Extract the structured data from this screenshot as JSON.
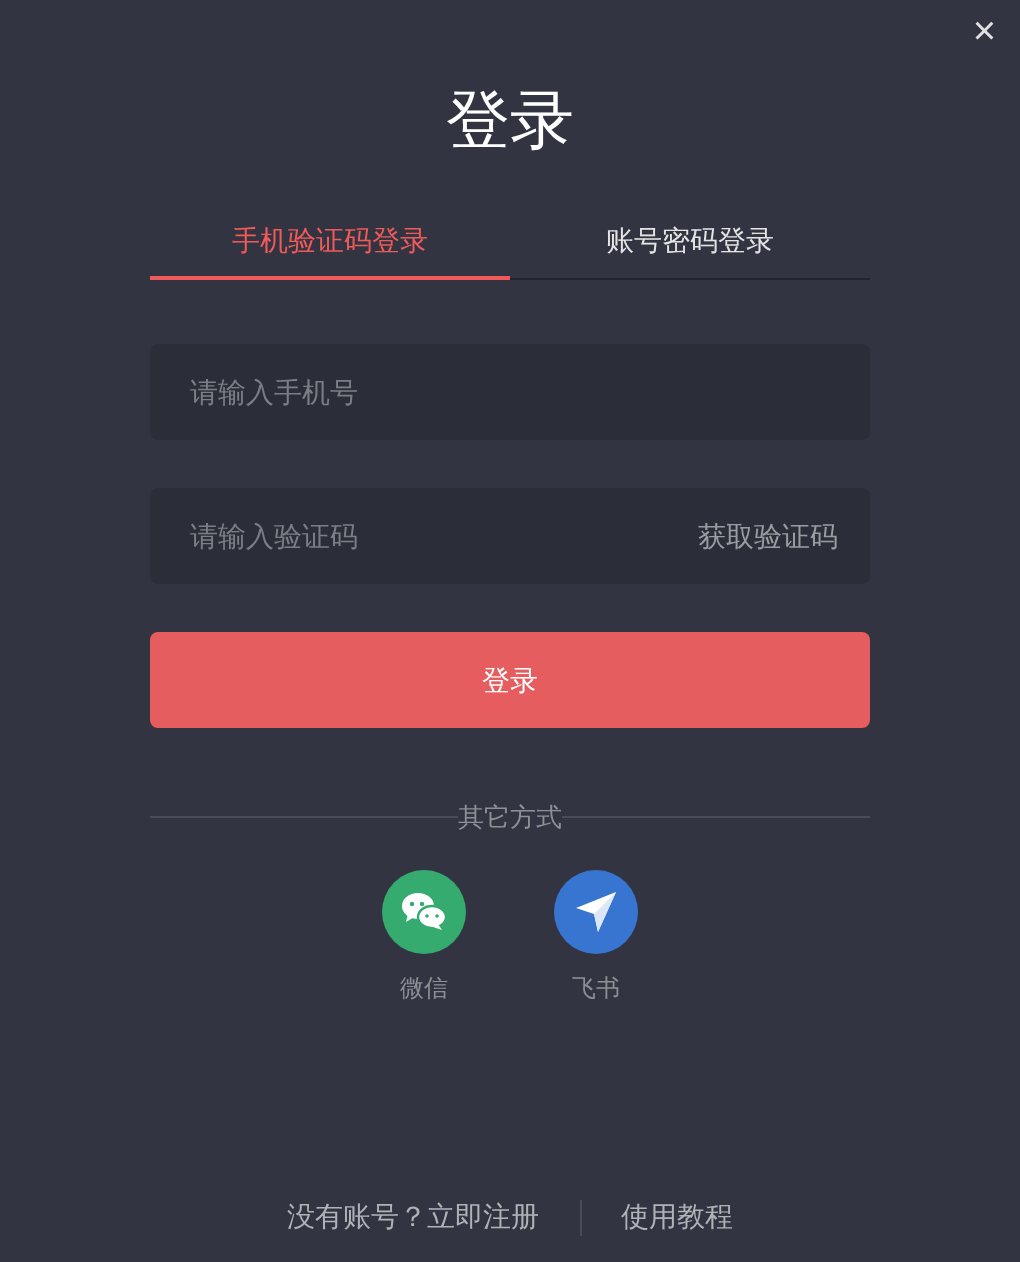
{
  "dialog": {
    "title": "登录",
    "close": "×"
  },
  "tabs": [
    {
      "label": "手机验证码登录",
      "selected": true
    },
    {
      "label": "账号密码登录",
      "selected": false
    }
  ],
  "phone_field": {
    "placeholder": "请输入手机号"
  },
  "code_field": {
    "placeholder": "请输入验证码",
    "action": "获取验证码"
  },
  "login_button": "登录",
  "divider_label": "其它方式",
  "alt_logins": [
    {
      "kind": "chat",
      "label": "微信",
      "color": "#36ab6f"
    },
    {
      "kind": "plane",
      "label": "飞书",
      "color": "#3775d0"
    }
  ],
  "footer": {
    "register": "没有账号？立即注册",
    "tutorial": "使用教程"
  }
}
